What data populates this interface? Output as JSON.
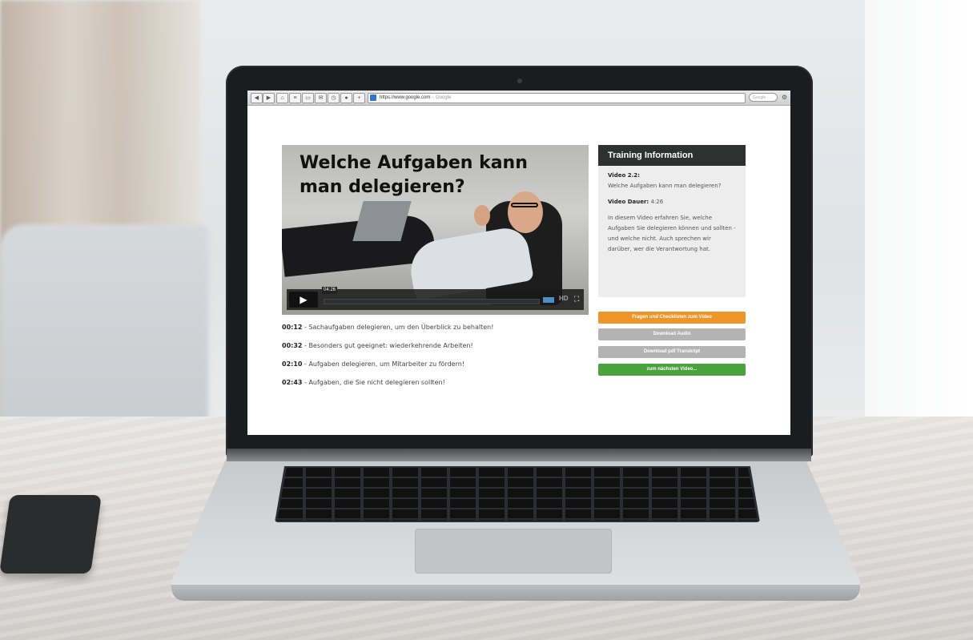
{
  "browser": {
    "url": "https://www.google.com",
    "url_suffix": "– Google",
    "search_placeholder": "Google"
  },
  "video": {
    "title": "Welche Aufgaben kann man delegieren?",
    "time": "04:26",
    "quality_label": "HD",
    "progress": 0.0
  },
  "chapters": [
    {
      "time": "00:12",
      "text": " - Sachaufgaben delegieren, um den Überblick zu behalten!"
    },
    {
      "time": "00:32",
      "text": " - Besonders gut geeignet: wiederkehrende Arbeiten!"
    },
    {
      "time": "02:10",
      "text": " - Aufgaben delegieren, um Mitarbeiter zu fördern!"
    },
    {
      "time": "02:43",
      "text": " - Aufgaben, die Sie nicht delegieren sollten!"
    }
  ],
  "info": {
    "heading": "Training Information",
    "video_label": "Video 2.2:",
    "video_name": "Welche Aufgaben kann man delegieren?",
    "duration_label": "Video Dauer:",
    "duration_value": " 4:26",
    "description": "In diesem Video erfahren Sie, welche Aufgaben Sie delegieren können und sollten  - und welche nicht. Auch sprechen wir darüber, wer die Verantwortung hat."
  },
  "buttons": {
    "questions": "Fragen und Checklisten zum Video",
    "audio": "Download Audio",
    "transcript": "Download pdf Transkript",
    "next": "zum nächsten Video..."
  },
  "colors": {
    "questions_btn": "#f0952a",
    "audio_btn": "#b3b3b3",
    "transcript_btn": "#b3b3b3",
    "next_btn": "#4aa23c",
    "panel_header": "#2f3030"
  }
}
